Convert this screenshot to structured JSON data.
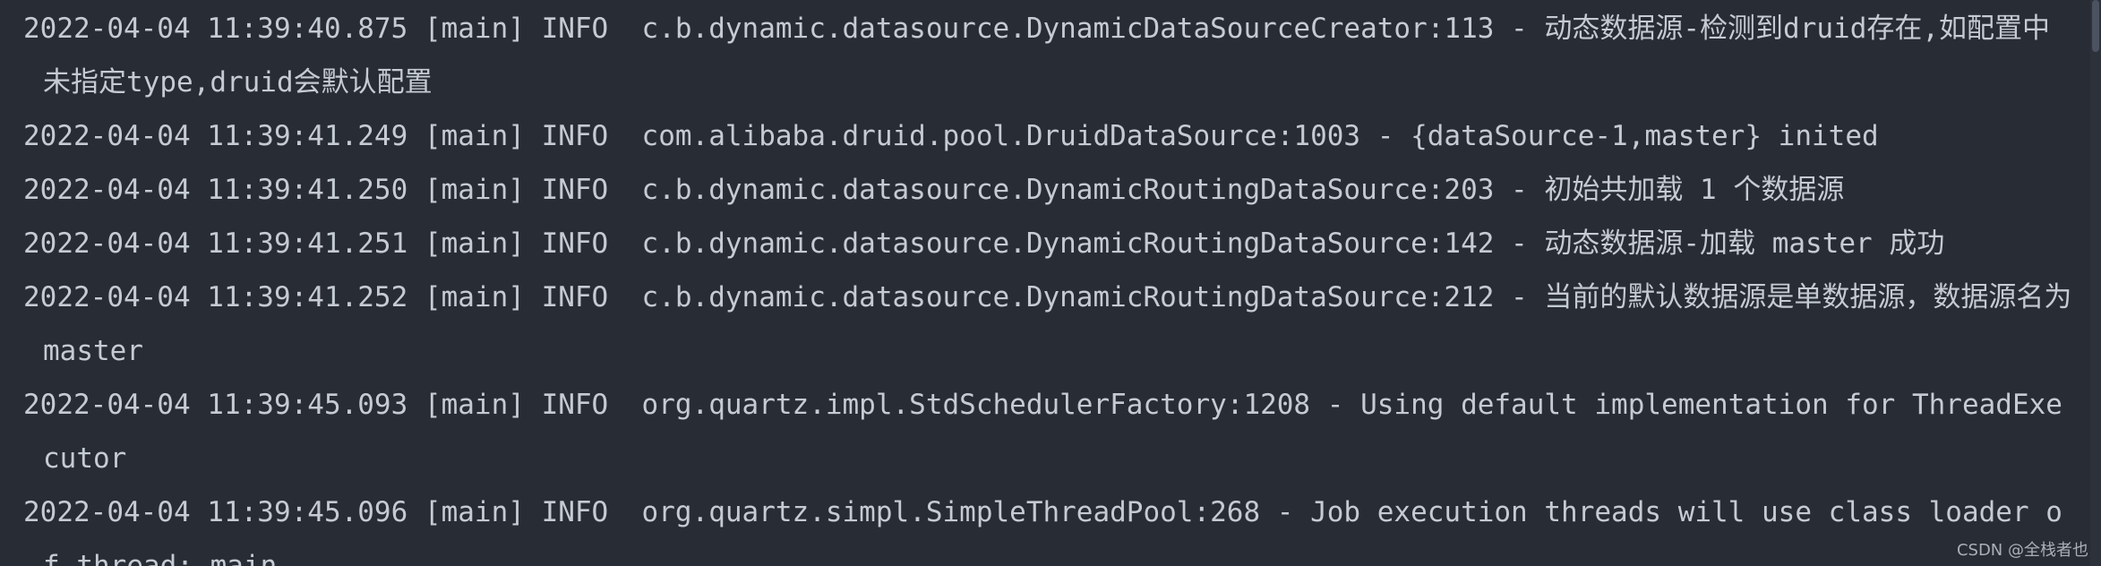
{
  "console": {
    "lines": [
      "2022-04-04 11:39:40.875 [main] INFO  c.b.dynamic.datasource.DynamicDataSourceCreator:113 - 动态数据源-检测到druid存在,如配置中未指定type,druid会默认配置",
      "2022-04-04 11:39:41.249 [main] INFO  com.alibaba.druid.pool.DruidDataSource:1003 - {dataSource-1,master} inited",
      "2022-04-04 11:39:41.250 [main] INFO  c.b.dynamic.datasource.DynamicRoutingDataSource:203 - 初始共加载 1 个数据源",
      "2022-04-04 11:39:41.251 [main] INFO  c.b.dynamic.datasource.DynamicRoutingDataSource:142 - 动态数据源-加载 master 成功",
      "2022-04-04 11:39:41.252 [main] INFO  c.b.dynamic.datasource.DynamicRoutingDataSource:212 - 当前的默认数据源是单数据源，数据源名为 master",
      "2022-04-04 11:39:45.093 [main] INFO  org.quartz.impl.StdSchedulerFactory:1208 - Using default implementation for ThreadExecutor",
      "2022-04-04 11:39:45.096 [main] INFO  org.quartz.simpl.SimpleThreadPool:268 - Job execution threads will use class loader of thread: main"
    ]
  },
  "watermark": "CSDN @全栈者也"
}
